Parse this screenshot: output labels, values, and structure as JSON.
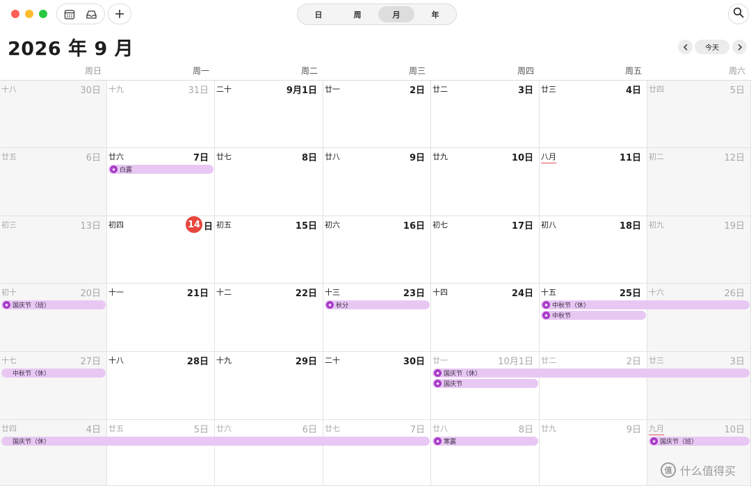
{
  "toolbar": {
    "view_buttons": [
      {
        "label": "日",
        "active": false
      },
      {
        "label": "周",
        "active": false
      },
      {
        "label": "月",
        "active": true
      },
      {
        "label": "年",
        "active": false
      }
    ],
    "icons": [
      "calendar-list-icon",
      "inbox-icon",
      "plus-icon",
      "search-icon"
    ]
  },
  "title": "2026 年 9 月",
  "nav": {
    "today_label": "今天"
  },
  "weekdays": [
    "周日",
    "周一",
    "周二",
    "周三",
    "周四",
    "周五",
    "周六"
  ],
  "colors": {
    "event_fill": "#e8c8f3",
    "event_icon": "#a93ac9",
    "today_badge": "#e8453c",
    "month_start_underline": "#e0505a"
  },
  "weeks": [
    [
      {
        "lunar": "十八",
        "day": "30日",
        "dim": true
      },
      {
        "lunar": "十九",
        "day": "31日",
        "dim": true
      },
      {
        "lunar": "二十",
        "day": "9月1日"
      },
      {
        "lunar": "廿一",
        "day": "2日"
      },
      {
        "lunar": "廿二",
        "day": "3日"
      },
      {
        "lunar": "廿三",
        "day": "4日"
      },
      {
        "lunar": "廿四",
        "day": "5日"
      }
    ],
    [
      {
        "lunar": "廿五",
        "day": "6日"
      },
      {
        "lunar": "廿六",
        "day": "7日"
      },
      {
        "lunar": "廿七",
        "day": "8日"
      },
      {
        "lunar": "廿八",
        "day": "9日"
      },
      {
        "lunar": "廿九",
        "day": "10日"
      },
      {
        "lunar": "八月",
        "day": "11日",
        "month_start": true
      },
      {
        "lunar": "初二",
        "day": "12日"
      }
    ],
    [
      {
        "lunar": "初三",
        "day": "13日"
      },
      {
        "lunar": "初四",
        "day": "日",
        "today": true,
        "today_num": "14"
      },
      {
        "lunar": "初五",
        "day": "15日"
      },
      {
        "lunar": "初六",
        "day": "16日"
      },
      {
        "lunar": "初七",
        "day": "17日"
      },
      {
        "lunar": "初八",
        "day": "18日"
      },
      {
        "lunar": "初九",
        "day": "19日"
      }
    ],
    [
      {
        "lunar": "初十",
        "day": "20日"
      },
      {
        "lunar": "十一",
        "day": "21日"
      },
      {
        "lunar": "十二",
        "day": "22日"
      },
      {
        "lunar": "十三",
        "day": "23日"
      },
      {
        "lunar": "十四",
        "day": "24日"
      },
      {
        "lunar": "十五",
        "day": "25日"
      },
      {
        "lunar": "十六",
        "day": "26日"
      }
    ],
    [
      {
        "lunar": "十七",
        "day": "27日"
      },
      {
        "lunar": "十八",
        "day": "28日"
      },
      {
        "lunar": "十九",
        "day": "29日"
      },
      {
        "lunar": "二十",
        "day": "30日"
      },
      {
        "lunar": "廿一",
        "day": "10月1日",
        "dim": true
      },
      {
        "lunar": "廿二",
        "day": "2日",
        "dim": true
      },
      {
        "lunar": "廿三",
        "day": "3日",
        "dim": true
      }
    ],
    [
      {
        "lunar": "廿四",
        "day": "4日",
        "dim": true
      },
      {
        "lunar": "廿五",
        "day": "5日",
        "dim": true
      },
      {
        "lunar": "廿六",
        "day": "6日",
        "dim": true
      },
      {
        "lunar": "廿七",
        "day": "7日",
        "dim": true
      },
      {
        "lunar": "廿八",
        "day": "8日",
        "dim": true
      },
      {
        "lunar": "廿九",
        "day": "9日",
        "dim": true
      },
      {
        "lunar": "九月",
        "day": "10日",
        "dim": true,
        "month_start": true
      }
    ]
  ],
  "events": [
    {
      "week": 1,
      "start": 1,
      "span": 1,
      "lane": 0,
      "label": "白露",
      "icon": true
    },
    {
      "week": 3,
      "start": 0,
      "span": 1,
      "lane": 0,
      "label": "国庆节（班）",
      "icon": true
    },
    {
      "week": 3,
      "start": 3,
      "span": 1,
      "lane": 0,
      "label": "秋分",
      "icon": true
    },
    {
      "week": 3,
      "start": 5,
      "span": 2,
      "lane": 0,
      "label": "中秋节（休）",
      "icon": true
    },
    {
      "week": 3,
      "start": 5,
      "span": 1,
      "lane": 1,
      "label": "中秋节",
      "icon": true
    },
    {
      "week": 4,
      "start": 0,
      "span": 1,
      "lane": 0,
      "label": "中秋节（休）",
      "icon": false
    },
    {
      "week": 4,
      "start": 4,
      "span": 3,
      "lane": 0,
      "label": "国庆节（休）",
      "icon": true
    },
    {
      "week": 4,
      "start": 4,
      "span": 1,
      "lane": 1,
      "label": "国庆节",
      "icon": true
    },
    {
      "week": 5,
      "start": 0,
      "span": 4,
      "lane": 0,
      "label": "国庆节（休）",
      "icon": false
    },
    {
      "week": 5,
      "start": 4,
      "span": 1,
      "lane": 0,
      "label": "寒露",
      "icon": true
    },
    {
      "week": 5,
      "start": 6,
      "span": 1,
      "lane": 0,
      "label": "国庆节（班）",
      "icon": true
    }
  ],
  "watermark": {
    "text": "什么值得买",
    "logo": "值"
  }
}
